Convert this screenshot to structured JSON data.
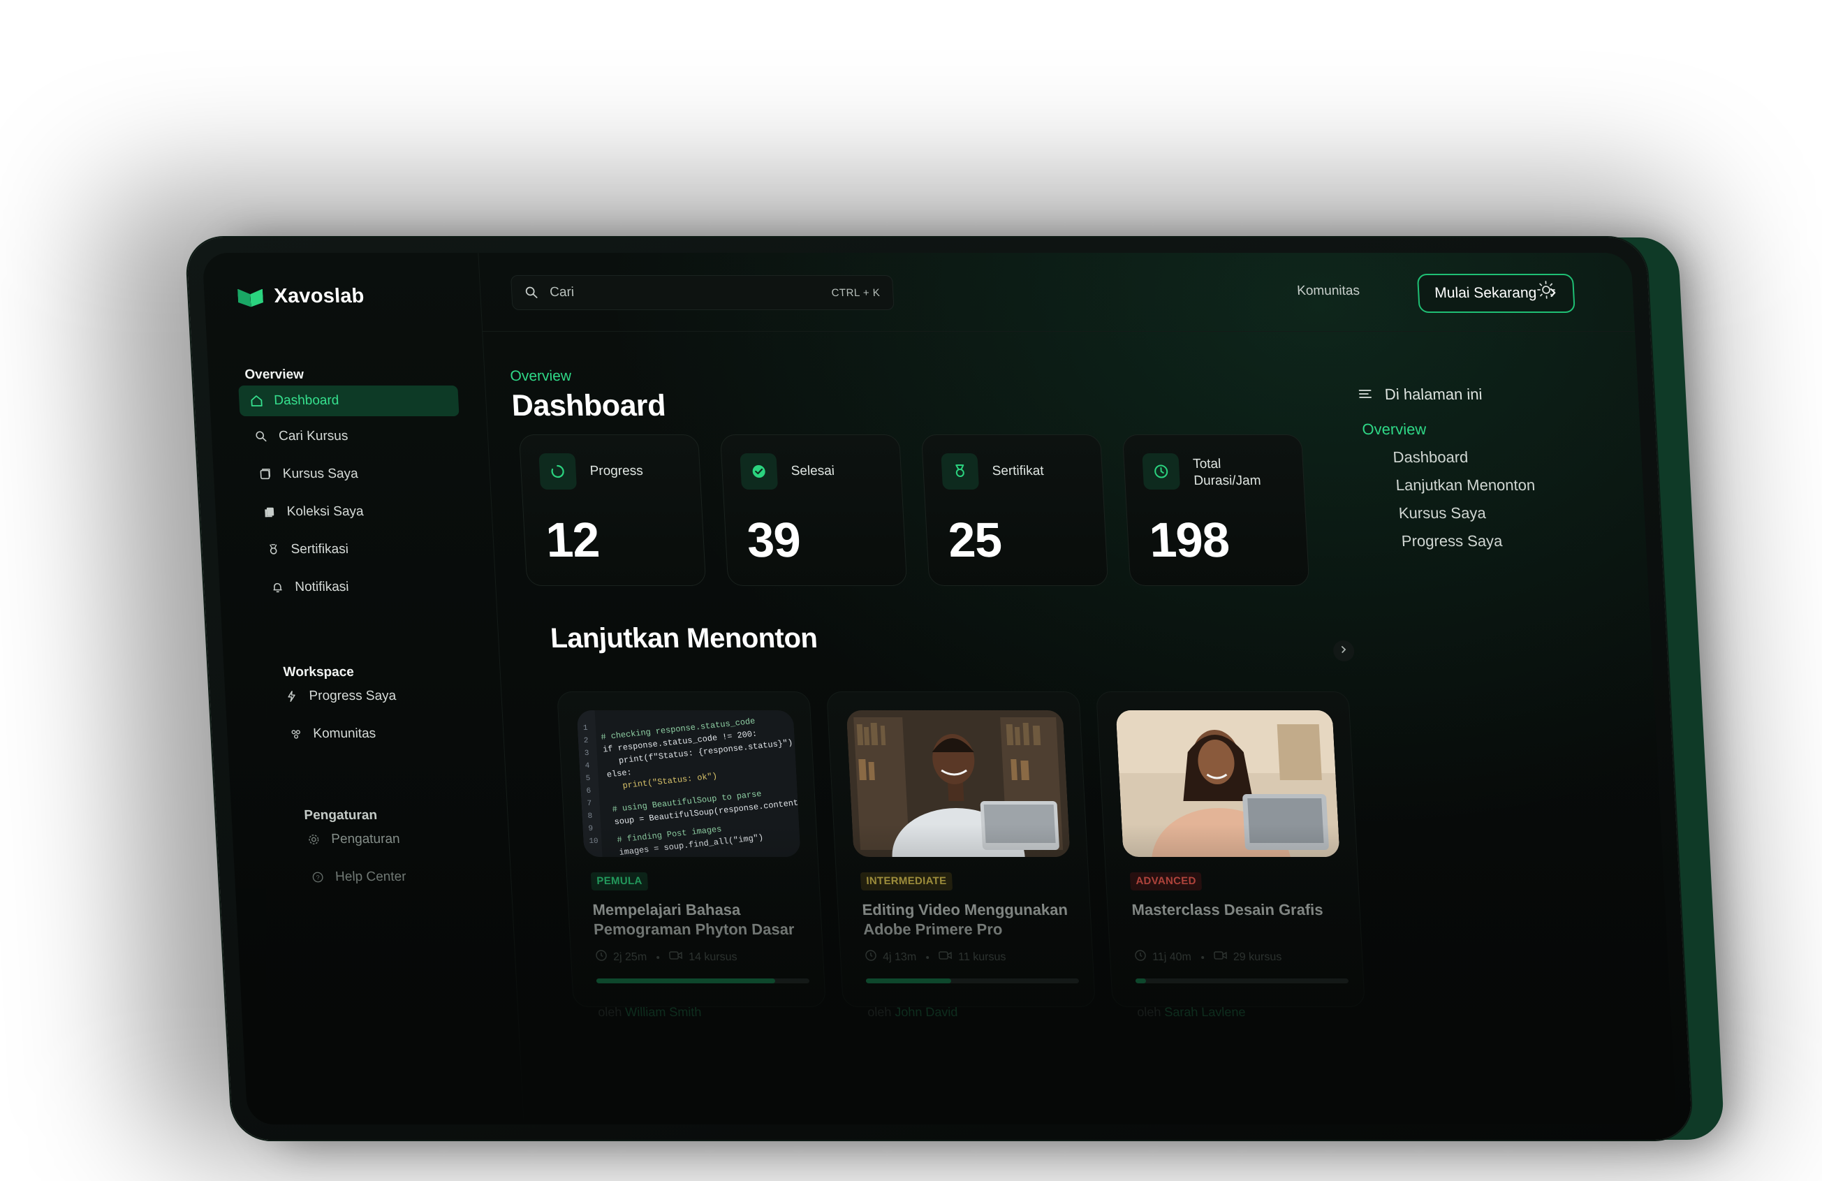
{
  "brand": {
    "name": "Xavoslab"
  },
  "sidebar": {
    "sections": [
      {
        "heading": "Overview",
        "items": [
          {
            "label": "Dashboard",
            "icon": "home-icon",
            "active": true
          },
          {
            "label": "Cari Kursus",
            "icon": "search-icon"
          },
          {
            "label": "Kursus Saya",
            "icon": "book-icon"
          },
          {
            "label": "Koleksi Saya",
            "icon": "collection-icon"
          },
          {
            "label": "Sertifikasi",
            "icon": "certificate-icon"
          },
          {
            "label": "Notifikasi",
            "icon": "bell-icon"
          }
        ]
      },
      {
        "heading": "Workspace",
        "items": [
          {
            "label": "Progress Saya",
            "icon": "bolt-icon"
          },
          {
            "label": "Komunitas",
            "icon": "users-icon"
          }
        ]
      },
      {
        "heading": "Pengaturan",
        "items": [
          {
            "label": "Pengaturan",
            "icon": "gear-icon"
          },
          {
            "label": "Help Center",
            "icon": "help-icon"
          }
        ]
      }
    ]
  },
  "topbar": {
    "search_placeholder": "Cari",
    "search_shortcut": "CTRL + K",
    "community_link": "Komunitas",
    "cta_label": "Mulai Sekarang",
    "theme_icon": "sun-icon"
  },
  "main": {
    "breadcrumb": "Overview",
    "title": "Dashboard",
    "stats": [
      {
        "label": "Progress",
        "value": "12",
        "icon": "spinner-icon"
      },
      {
        "label": "Selesai",
        "value": "39",
        "icon": "check-circle-icon"
      },
      {
        "label": "Sertifikat",
        "value": "25",
        "icon": "medal-icon"
      },
      {
        "label": "Total Durasi/Jam",
        "value": "198",
        "icon": "clock-icon"
      }
    ],
    "continue_title": "Lanjutkan Menonton",
    "courses": [
      {
        "level": "PEMULA",
        "level_color": "#1aa765",
        "title": "Mempelajari Bahasa Pemograman Phyton Dasar",
        "duration": "2j 25m",
        "lessons": "14 kursus",
        "progress": 0.84,
        "by": "oleh",
        "author": "William Smith"
      },
      {
        "level": "INTERMEDIATE",
        "level_color": "#c8b34a",
        "title": "Editing Video Menggunakan Adobe Primere Pro",
        "duration": "4j 13m",
        "lessons": "11 kursus",
        "progress": 0.4,
        "by": "oleh",
        "author": "John David"
      },
      {
        "level": "ADVANCED",
        "level_color": "#e0544a",
        "title": "Masterclass Desain Grafis",
        "duration": "11j 40m",
        "lessons": "29 kursus",
        "progress": 0.05,
        "by": "oleh",
        "author": "Sarah Lavlene"
      }
    ]
  },
  "toc": {
    "heading": "Di halaman ini",
    "items": [
      {
        "label": "Overview",
        "active": true
      },
      {
        "label": "Dashboard"
      },
      {
        "label": "Lanjutkan Menonton"
      },
      {
        "label": "Kursus Saya"
      },
      {
        "label": "Progress Saya"
      }
    ]
  }
}
